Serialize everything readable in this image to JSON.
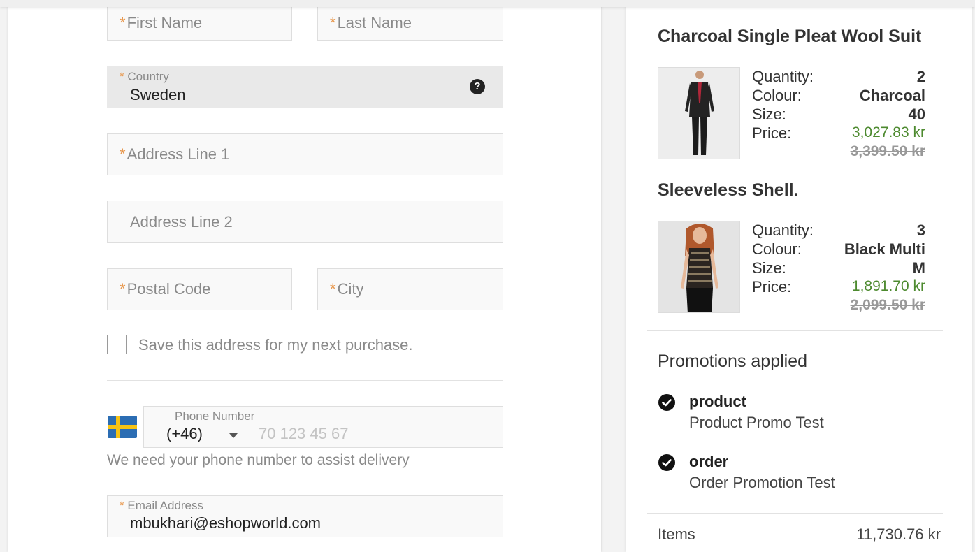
{
  "form": {
    "first_name_placeholder": "First Name",
    "last_name_placeholder": "Last Name",
    "country_label": "Country",
    "country_value": "Sweden",
    "help_icon_glyph": "?",
    "address1_placeholder": "Address Line 1",
    "address2_placeholder": "Address Line 2",
    "postal_code_placeholder": "Postal Code",
    "city_placeholder": "City",
    "save_address_label": "Save this address for my next purchase.",
    "required_marker": "*",
    "phone": {
      "label": "Phone Number",
      "country_code": "(+46)",
      "placeholder": "70 123 45 67",
      "helper": "We need your phone number to assist delivery",
      "flag_icon": "sweden-flag-icon"
    },
    "email_label": "Email Address",
    "email_value": "mbukhari@eshopworld.com"
  },
  "cart": {
    "products": [
      {
        "title": "Charcoal Single Pleat Wool Suit",
        "quantity_label": "Quantity:",
        "quantity": "2",
        "colour_label": "Colour:",
        "colour": "Charcoal",
        "size_label": "Size:",
        "size": "40",
        "price_label": "Price:",
        "price": "3,027.83 kr",
        "original_price": "3,399.50 kr"
      },
      {
        "title": "Sleeveless Shell.",
        "quantity_label": "Quantity:",
        "quantity": "3",
        "colour_label": "Colour:",
        "colour": "Black Multi",
        "size_label": "Size:",
        "size": "M",
        "price_label": "Price:",
        "price": "1,891.70 kr",
        "original_price": "2,099.50 kr"
      }
    ],
    "promotions_heading": "Promotions applied",
    "promotions": [
      {
        "name": "product",
        "description": "Product Promo Test"
      },
      {
        "name": "order",
        "description": "Order Promotion Test"
      }
    ],
    "items_label": "Items",
    "items_total": "11,730.76 kr"
  },
  "colors": {
    "required_star": "#e8964a",
    "price_green": "#4d8a2f",
    "flag_blue": "#2b6db3",
    "flag_yellow": "#f6c315"
  }
}
